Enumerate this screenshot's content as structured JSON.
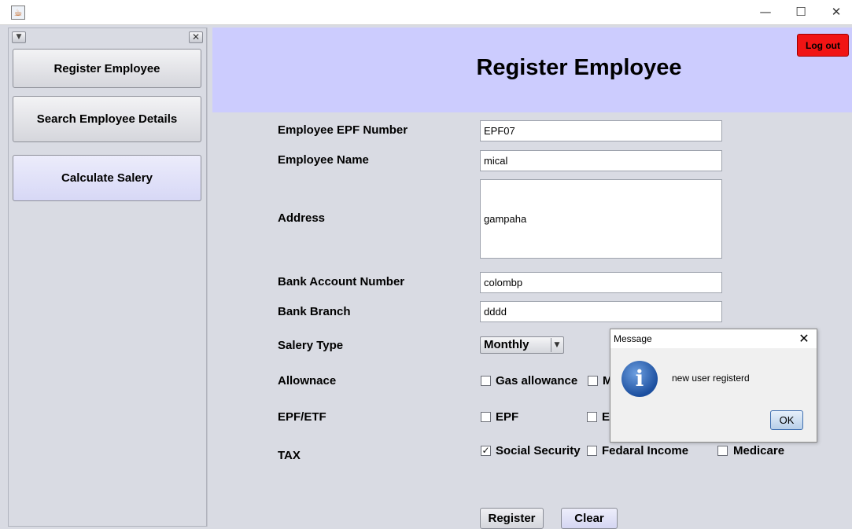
{
  "window": {
    "minimize_icon": "—",
    "maximize_icon": "☐",
    "close_icon": "✕"
  },
  "sidebar": {
    "items": [
      {
        "label": "Register Employee"
      },
      {
        "label": "Search Employee Details"
      },
      {
        "label": "Calculate Salery"
      }
    ]
  },
  "header": {
    "title": "Register Employee",
    "logout_label": "Log out",
    "logout_color": "#f11414",
    "header_color": "#ccccfe"
  },
  "form": {
    "labels": {
      "epf_number": "Employee EPF Number",
      "name": "Employee Name",
      "address": "Address",
      "bank_account": "Bank Account Number",
      "bank_branch": "Bank Branch",
      "salary_type": "Salery Type",
      "allowance": "Allownace",
      "epf_etf": "EPF/ETF",
      "tax": "TAX"
    },
    "values": {
      "epf_number": "EPF07",
      "name": "mical",
      "address": "gampaha",
      "bank_account": "colombp",
      "bank_branch": "dddd",
      "salary_type": "Monthly"
    },
    "allowance_options": [
      {
        "label": "Gas allowance",
        "checked": false
      },
      {
        "label": "M",
        "checked": false
      }
    ],
    "epf_options": [
      {
        "label": "EPF",
        "checked": false
      },
      {
        "label": "E",
        "checked": false
      }
    ],
    "tax_options": [
      {
        "label": "Social Security",
        "checked": true
      },
      {
        "label": "Fedaral Income",
        "checked": false
      },
      {
        "label": "Medicare",
        "checked": false
      }
    ],
    "register_label": "Register",
    "clear_label": "Clear"
  },
  "dialog": {
    "title": "Message",
    "message": "new user registerd",
    "ok_label": "OK",
    "icon": "info-icon",
    "icon_glyph": "i"
  }
}
